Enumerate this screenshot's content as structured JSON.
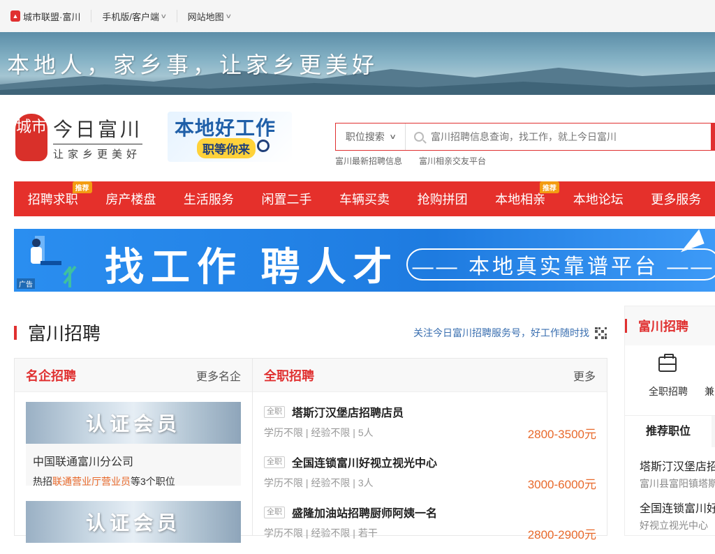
{
  "topbar": {
    "city_label": "城市联盟·富川",
    "mobile_label": "手机版/客户端",
    "sitemap_label": "网站地图"
  },
  "banner": {
    "slogan": "本地人，家乡事，让家乡更美好"
  },
  "logo": {
    "seal": "城市",
    "name": "今日富川",
    "tagline": "让家乡更美好"
  },
  "promo": {
    "line1": "本地好工作",
    "line2": "职等你来"
  },
  "search": {
    "category": "职位搜索",
    "placeholder": "富川招聘信息查询，找工作，就上今日富川",
    "hot_links": [
      "富川最新招聘信息",
      "富川相亲交友平台"
    ]
  },
  "nav": {
    "items": [
      {
        "label": "招聘求职",
        "badge": "推荐"
      },
      {
        "label": "房产楼盘",
        "badge": ""
      },
      {
        "label": "生活服务",
        "badge": ""
      },
      {
        "label": "闲置二手",
        "badge": ""
      },
      {
        "label": "车辆买卖",
        "badge": ""
      },
      {
        "label": "抢购拼团",
        "badge": ""
      },
      {
        "label": "本地相亲",
        "badge": "推荐"
      },
      {
        "label": "本地论坛",
        "badge": ""
      },
      {
        "label": "更多服务",
        "badge": ""
      }
    ]
  },
  "ad": {
    "headline": "找工作 聘人才",
    "pill": "—— 本地真实靠谱平台 ——",
    "tag": "广告"
  },
  "section": {
    "title": "富川招聘",
    "follow": "关注今日富川招聘服务号，好工作随时找"
  },
  "famous": {
    "title": "名企招聘",
    "more": "更多名企",
    "cards": [
      {
        "banner": "认证会员",
        "company": "中国联通富川分公司",
        "prefix": "热招",
        "role": "联通营业厅营业员",
        "suffix": "等3个职位"
      },
      {
        "banner": "认证会员"
      }
    ]
  },
  "fulltime": {
    "title": "全职招聘",
    "more": "更多",
    "jobs": [
      {
        "tag": "全职",
        "title": "塔斯汀汉堡店招聘店员",
        "info": "学历不限 | 经验不限 | 5人",
        "salary": "2800-3500元"
      },
      {
        "tag": "全职",
        "title": "全国连锁富川好视立视光中心",
        "info": "学历不限 | 经验不限 | 3人",
        "salary": "3000-6000元"
      },
      {
        "tag": "全职",
        "title": "盛隆加油站招聘厨师阿姨一名",
        "info": "学历不限 | 经验不限 | 若干",
        "salary": "2800-2900元"
      }
    ]
  },
  "sidebar": {
    "title": "富川招聘",
    "icon_label": "全职招聘",
    "icon_label2": "兼",
    "tab": "推荐职位",
    "items": [
      {
        "title": "塔斯汀汉堡店招",
        "sub": "富川县富阳镇塔斯"
      },
      {
        "title": "全国连锁富川好",
        "sub": "好视立视光中心"
      }
    ]
  }
}
